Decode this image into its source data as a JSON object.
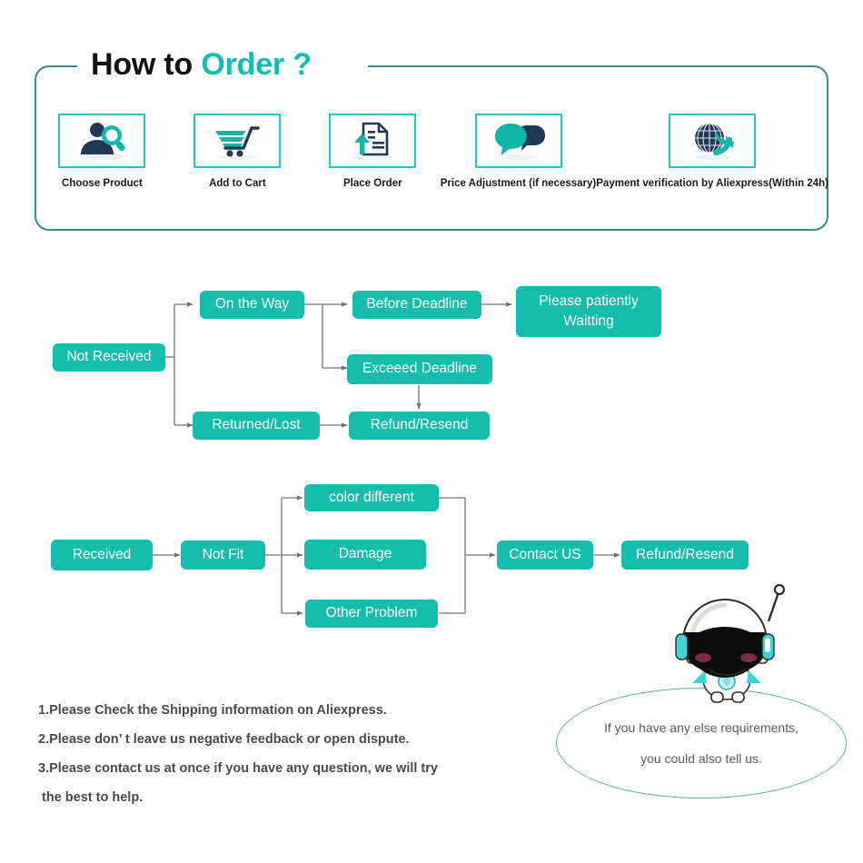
{
  "header": {
    "title_part1": "How to",
    "title_part2": "Order",
    "title_qmark": "?"
  },
  "steps": [
    {
      "icon": "person-search-icon",
      "label": "Choose  Product"
    },
    {
      "icon": "shopping-cart-icon",
      "label": "Add to Cart"
    },
    {
      "icon": "document-upload-icon",
      "label": "Place  Order"
    },
    {
      "icon": "speech-bubbles-icon",
      "label": "Price Adjustment\n(if necessary)"
    },
    {
      "icon": "globe-refresh-icon",
      "label": "Payment verification\nby Aliexpress(Within 24h)"
    }
  ],
  "flow_not_received": {
    "title": "not-received-flow",
    "boxes": [
      {
        "id": "not-received",
        "label": "Not Received"
      },
      {
        "id": "on-the-way",
        "label": "On the Way"
      },
      {
        "id": "returned-lost",
        "label": "Returned/Lost"
      },
      {
        "id": "before-deadline",
        "label": "Before Deadline"
      },
      {
        "id": "exceeed-deadline",
        "label": "Exceeed Deadline"
      },
      {
        "id": "please-waitting",
        "label": "Please patiently\nWaitting"
      },
      {
        "id": "refund-resend-1",
        "label": "Refund/Resend"
      }
    ]
  },
  "flow_received": {
    "title": "received-flow",
    "boxes": [
      {
        "id": "received",
        "label": "Received"
      },
      {
        "id": "not-fit",
        "label": "Not Fit"
      },
      {
        "id": "color-different",
        "label": "color different"
      },
      {
        "id": "damage",
        "label": "Damage"
      },
      {
        "id": "other-problem",
        "label": "Other Problem"
      },
      {
        "id": "contact-us",
        "label": "Contact US"
      },
      {
        "id": "refund-resend-2",
        "label": "Refund/Resend"
      }
    ]
  },
  "notes": [
    "1.Please Check the Shipping information on Aliexpress.",
    "2.Please don’ t leave us negative feedback or open dispute.",
    "3.Please contact us at once if you have any question, we will try",
    " the best to help."
  ],
  "bubble": {
    "line1": "If you have any else requirements,",
    "line2": "you could also tell us."
  },
  "colors": {
    "teal_box": "#14bdac",
    "teal_accent": "#11bfb1",
    "teal_border": "#20c8bd",
    "panel_border": "#2f8d8c",
    "navy": "#1f3a56",
    "connector": "#7a7a7a",
    "note_text": "#4a4a4a",
    "bubble_border": "#5fb0a8"
  }
}
